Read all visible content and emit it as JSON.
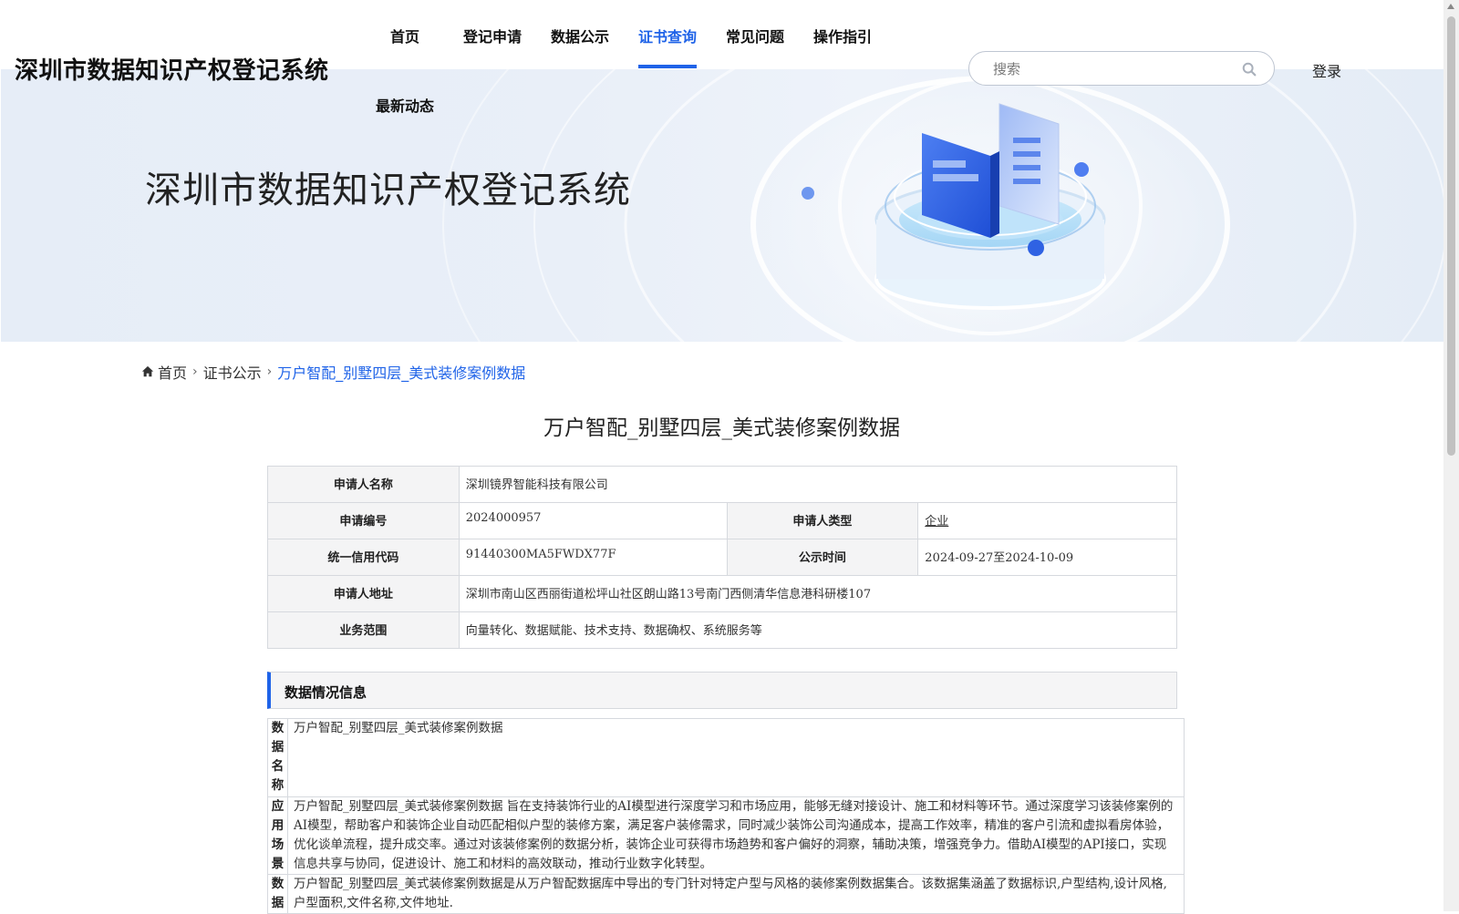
{
  "header": {
    "brand": "深圳市数据知识产权登记系统",
    "nav": [
      {
        "label": "首页"
      },
      {
        "label": "登记申请"
      },
      {
        "label": "数据公示"
      },
      {
        "label": "证书查询"
      },
      {
        "label": "常见问题"
      },
      {
        "label": "操作指引"
      },
      {
        "label": "最新动态"
      }
    ],
    "active_nav": "证书查询",
    "search_placeholder": "搜索",
    "login_label": "登录",
    "accent_color": "#1f63e8"
  },
  "banner": {
    "title": "深圳市数据知识产权登记系统"
  },
  "breadcrumb": {
    "home": "首页",
    "section": "证书公示",
    "current": "万户智配_别墅四层_美式装修案例数据"
  },
  "page_title": "万户智配_别墅四层_美式装修案例数据",
  "applicant": {
    "name_label": "申请人名称",
    "name_value": "深圳镜界智能科技有限公司",
    "number_label": "申请编号",
    "number_value": "2024000957",
    "type_label": "申请人类型",
    "type_value": "企业",
    "credit_label": "统一信用代码",
    "credit_value": "91440300MA5FWDX77F",
    "publish_label": "公示时间",
    "publish_value": "2024-09-27至2024-10-09",
    "address_label": "申请人地址",
    "address_value": "深圳市南山区西丽街道松坪山社区朗山路13号南门西侧清华信息港科研楼107",
    "scope_label": "业务范围",
    "scope_value": "向量转化、数据赋能、技术支持、数据确权、系统服务等"
  },
  "data_section": {
    "heading": "数据情况信息",
    "rows": [
      {
        "label": "数据名称",
        "value": "万户智配_别墅四层_美式装修案例数据"
      },
      {
        "label": "应用场景",
        "value": "万户智配_别墅四层_美式装修案例数据 旨在支持装饰行业的AI模型进行深度学习和市场应用，能够无缝对接设计、施工和材料等环节。通过深度学习该装修案例的AI模型，帮助客户和装饰企业自动匹配相似户型的装修方案，满足客户装修需求，同时减少装饰公司沟通成本，提高工作效率，精准的客户引流和虚拟看房体验，优化谈单流程，提升成交率。通过对该装修案例的数据分析，装饰企业可获得市场趋势和客户偏好的洞察，辅助决策，增强竞争力。借助AI模型的API接口，实现信息共享与协同，促进设计、施工和材料的高效联动，推动行业数字化转型。"
      },
      {
        "label": "数据",
        "value": "万户智配_别墅四层_美式装修案例数据是从万户智配数据库中导出的专门针对特定户型与风格的装修案例数据集合。该数据集涵盖了数据标识,户型结构,设计风格,户型面积,文件名称,文件地址."
      }
    ]
  }
}
